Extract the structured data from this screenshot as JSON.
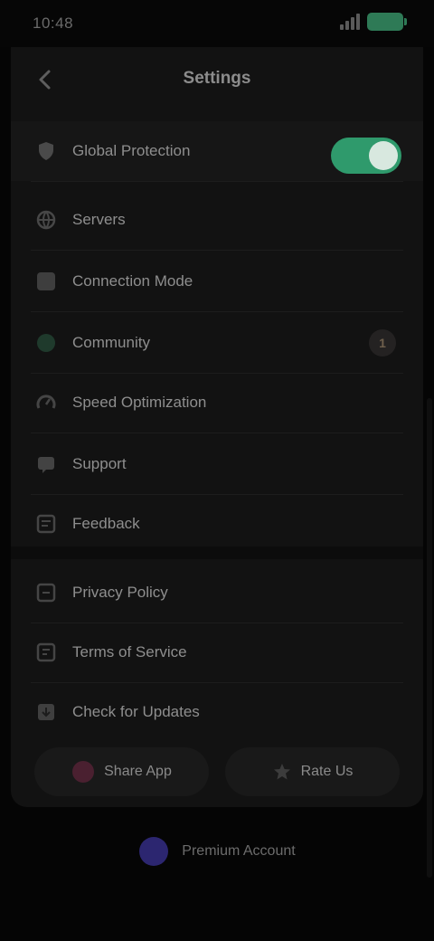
{
  "status_bar": {
    "time": "10:48",
    "battery_color": "#2e7a56"
  },
  "header": {
    "title": "Settings"
  },
  "rows": [
    {
      "label": "Global Protection",
      "icon": "shield-icon",
      "control": "toggle",
      "toggle_on": true,
      "accent": "#2f9a6c"
    },
    {
      "label": "Servers",
      "icon": "globe-icon"
    },
    {
      "label": "Connection Mode",
      "icon": "mode-icon"
    },
    {
      "label": "Community",
      "icon": "community-icon",
      "badge": "1"
    },
    {
      "label": "Speed Optimization",
      "icon": "speed-icon"
    },
    {
      "label": "Support",
      "icon": "support-icon"
    },
    {
      "label": "Feedback",
      "icon": "feedback-icon"
    },
    {
      "label": "Privacy Policy",
      "icon": "privacy-icon"
    },
    {
      "label": "Terms of Service",
      "icon": "terms-icon"
    },
    {
      "label": "Check for Updates",
      "icon": "update-icon"
    }
  ],
  "actions": {
    "left_label": "Share App",
    "right_label": "Rate Us"
  },
  "footer": {
    "label": "Premium Account"
  }
}
